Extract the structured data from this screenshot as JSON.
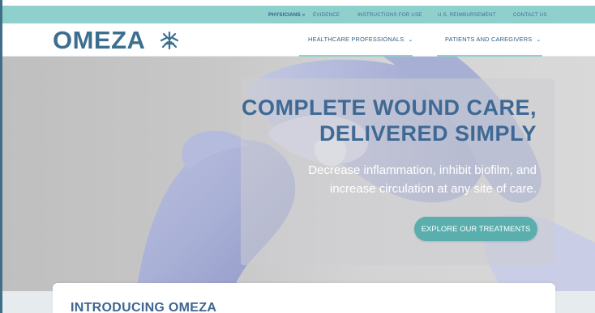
{
  "topbar": {
    "physicians_label": "PHYSICIANS »",
    "links": [
      "EVIDENCE",
      "INSTRUCTIONS FOR USE",
      "U.S. REIMBURSEMENT",
      "CONTACT US"
    ]
  },
  "header": {
    "logo_text": "OMEZA",
    "nav": [
      {
        "label": "HEALTHCARE PROFESSIONALS",
        "chevron": "⌄"
      },
      {
        "label": "PATIENTS AND CAREGIVERS",
        "chevron": "⌄"
      }
    ]
  },
  "hero": {
    "headline_line1": "COMPLETE WOUND CARE,",
    "headline_line2": "DELIVERED SIMPLY",
    "subtext_line1": "Decrease inflammation, inhibit biofilm, and",
    "subtext_line2": "increase circulation at any site of care.",
    "cta_label": "EXPLORE OUR TREATMENTS"
  },
  "intro": {
    "title": "INTRODUCING OMEZA"
  },
  "colors": {
    "accent_teal": "#8fd0cd",
    "button_teal": "#5aaeae",
    "brand_blue": "#3c6f8f"
  }
}
